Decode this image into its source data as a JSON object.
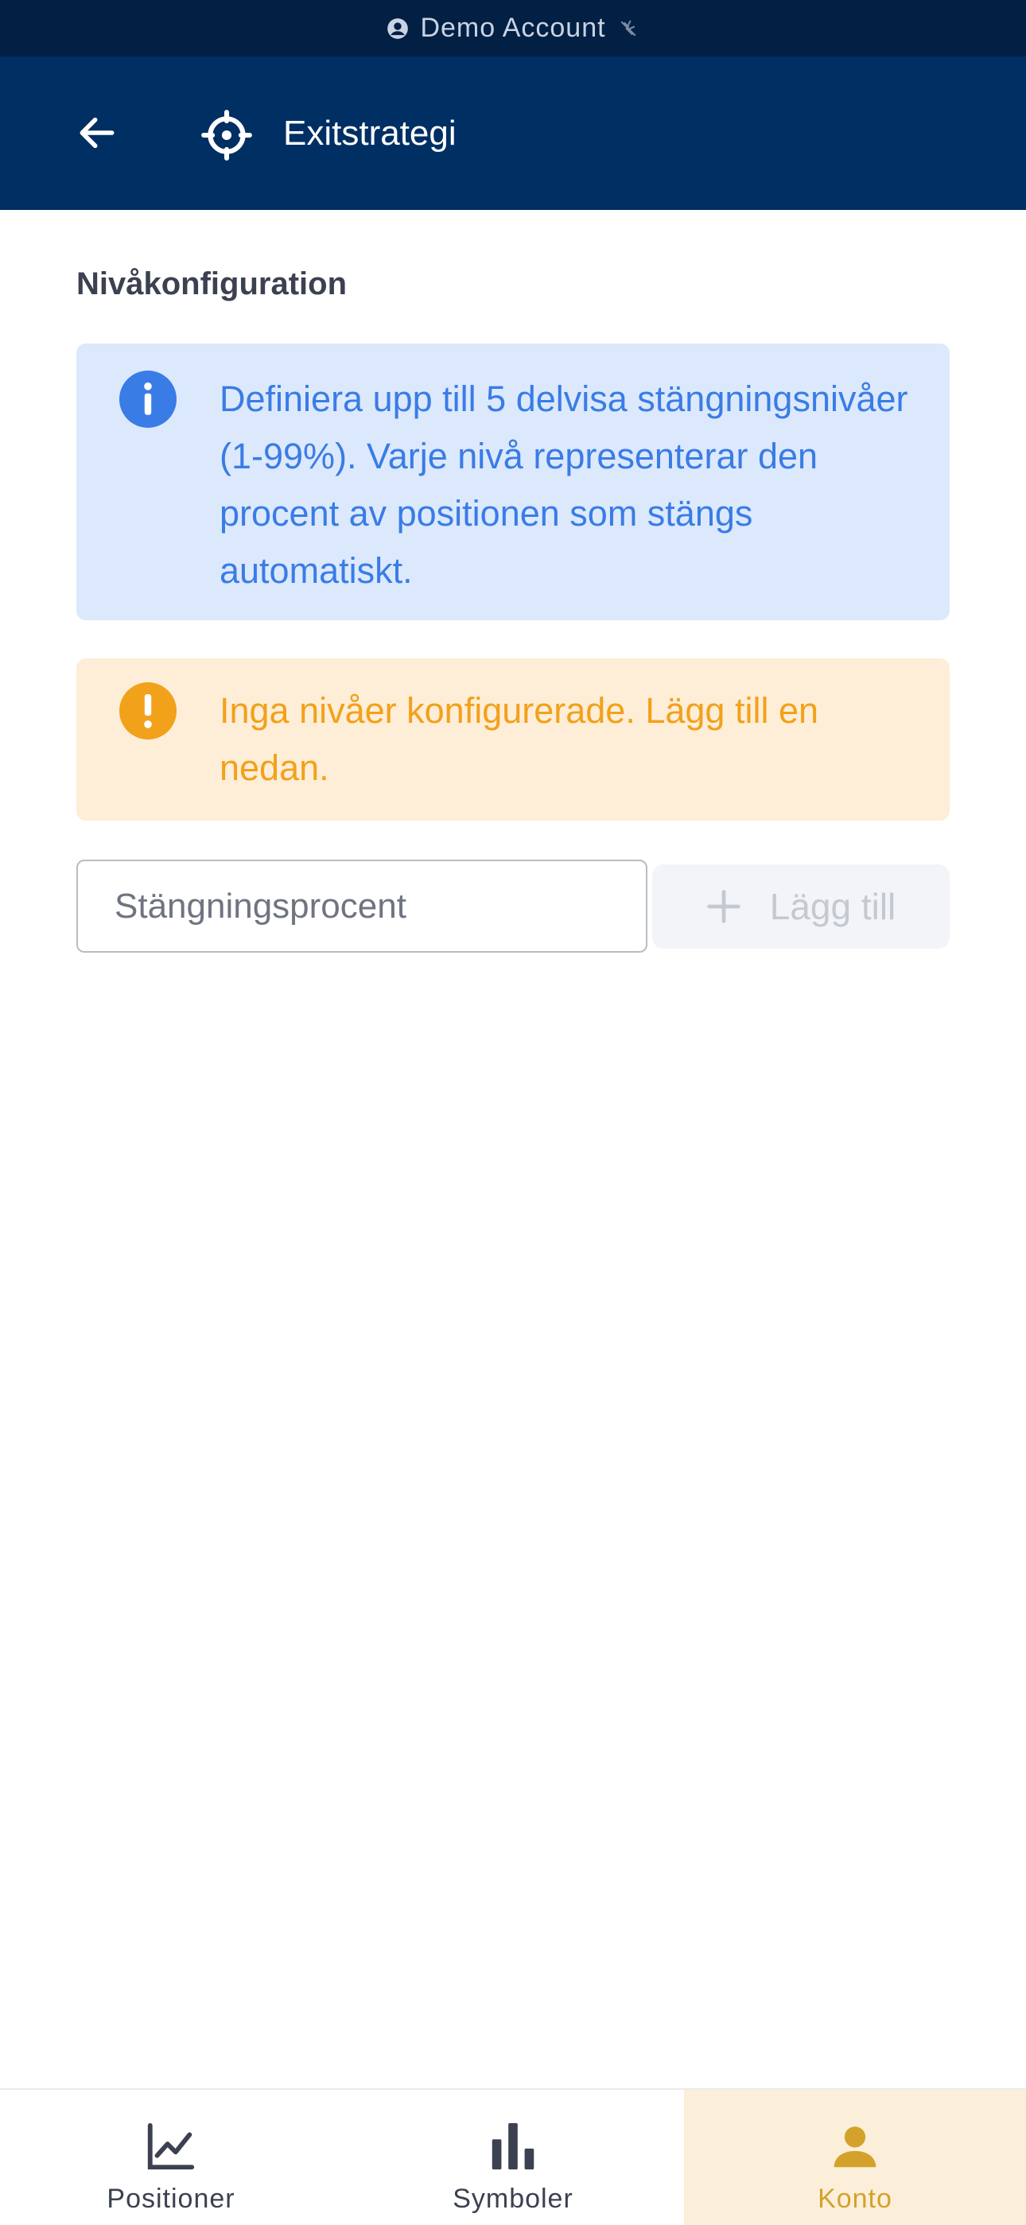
{
  "status_bar": {
    "account_label": "Demo Account"
  },
  "app_bar": {
    "title": "Exitstrategi"
  },
  "section": {
    "title": "Nivåkonfiguration"
  },
  "info": {
    "message": "Definiera upp till 5 delvisa stängningsnivåer (1-99%). Varje nivå representerar den procent av positionen som stängs automatiskt."
  },
  "warning": {
    "message": "Inga nivåer konfigurerade. Lägg till en nedan."
  },
  "form": {
    "placeholder": "Stängningsprocent",
    "value": "",
    "add_label": "Lägg till"
  },
  "bottom_nav": {
    "items": [
      {
        "label": "Positioner",
        "icon": "line-chart-icon",
        "active": false
      },
      {
        "label": "Symboler",
        "icon": "bar-chart-icon",
        "active": false
      },
      {
        "label": "Konto",
        "icon": "person-icon",
        "active": true
      }
    ]
  },
  "colors": {
    "status_bar_bg": "#021f44",
    "app_bar_bg": "#002f63",
    "info_bg": "#dce9fc",
    "info_text": "#3a7ce6",
    "warning_bg": "#feeed8",
    "warning_text": "#f2a11a",
    "active_nav_bg": "#fbefda",
    "active_nav_text": "#d4a12a"
  }
}
